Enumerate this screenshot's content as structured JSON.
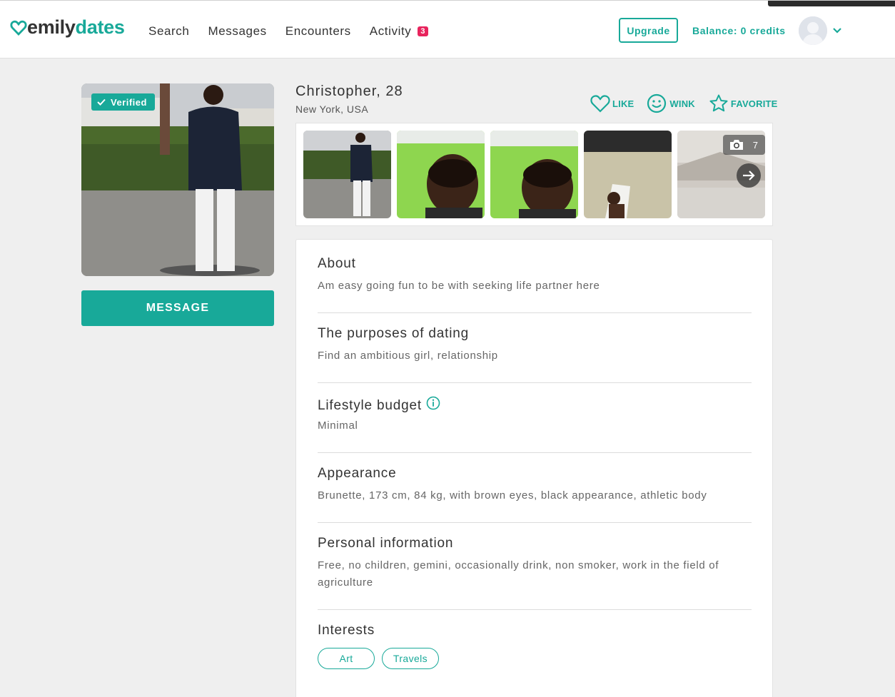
{
  "brand": {
    "name_part1": "emily",
    "name_part2": "dates",
    "accent": "#18a999"
  },
  "nav": {
    "items": [
      "Search",
      "Messages",
      "Encounters",
      "Activity"
    ],
    "activity_badge": "3"
  },
  "header": {
    "upgrade_label": "Upgrade",
    "balance_text": "Balance: 0 credits"
  },
  "profile": {
    "name_age": "Christopher, 28",
    "location": "New York, USA",
    "verified_label": "Verified",
    "message_label": "MESSAGE",
    "actions": {
      "like": "LIKE",
      "wink": "WINK",
      "favorite": "FAVORITE"
    },
    "photo_count": "7"
  },
  "sections": {
    "about": {
      "title": "About",
      "text": "Am easy going fun to be with seeking life partner here"
    },
    "purposes": {
      "title": "The purposes of dating",
      "text": "Find an ambitious girl, relationship"
    },
    "lifestyle": {
      "title": "Lifestyle budget",
      "text": "Minimal"
    },
    "appearance": {
      "title": "Appearance",
      "text": "Brunette, 173 cm, 84 kg, with brown eyes, black appearance, athletic body"
    },
    "personal": {
      "title": "Personal information",
      "text": "Free, no children, gemini, occasionally drink, non smoker, work in the field of agriculture"
    },
    "interests": {
      "title": "Interests",
      "tags": [
        "Art",
        "Travels"
      ]
    }
  }
}
